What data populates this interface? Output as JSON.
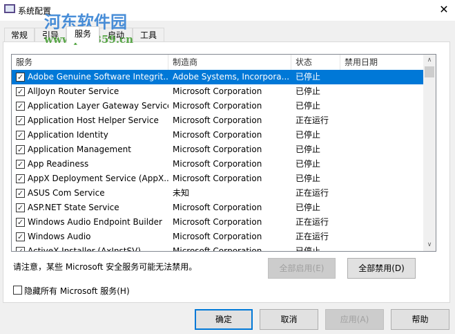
{
  "window": {
    "title": "系统配置",
    "close": "✕"
  },
  "watermark": {
    "line1": "河东软件园",
    "line2": "www.pc0359.cn"
  },
  "tabs": [
    "常规",
    "引导",
    "服务",
    "启动",
    "工具"
  ],
  "columns": [
    "服务",
    "制造商",
    "状态",
    "禁用日期"
  ],
  "rows": [
    {
      "name": "Adobe Genuine Software Integrit...",
      "maker": "Adobe Systems, Incorpora...",
      "status": "已停止",
      "date": ""
    },
    {
      "name": "AllJoyn Router Service",
      "maker": "Microsoft Corporation",
      "status": "已停止",
      "date": ""
    },
    {
      "name": "Application Layer Gateway Service",
      "maker": "Microsoft Corporation",
      "status": "已停止",
      "date": ""
    },
    {
      "name": "Application Host Helper Service",
      "maker": "Microsoft Corporation",
      "status": "正在运行",
      "date": ""
    },
    {
      "name": "Application Identity",
      "maker": "Microsoft Corporation",
      "status": "已停止",
      "date": ""
    },
    {
      "name": "Application Management",
      "maker": "Microsoft Corporation",
      "status": "已停止",
      "date": ""
    },
    {
      "name": "App Readiness",
      "maker": "Microsoft Corporation",
      "status": "已停止",
      "date": ""
    },
    {
      "name": "AppX Deployment Service (AppX...",
      "maker": "Microsoft Corporation",
      "status": "已停止",
      "date": ""
    },
    {
      "name": "ASUS Com Service",
      "maker": "未知",
      "status": "正在运行",
      "date": ""
    },
    {
      "name": "ASP.NET State Service",
      "maker": "Microsoft Corporation",
      "status": "已停止",
      "date": ""
    },
    {
      "name": "Windows Audio Endpoint Builder",
      "maker": "Microsoft Corporation",
      "status": "正在运行",
      "date": ""
    },
    {
      "name": "Windows Audio",
      "maker": "Microsoft Corporation",
      "status": "正在运行",
      "date": ""
    },
    {
      "name": "ActiveX Installer (AxInstSV)",
      "maker": "Microsoft Corporation",
      "status": "已停止",
      "date": ""
    }
  ],
  "note": "请注意，某些 Microsoft 安全服务可能无法禁用。",
  "enable_all": "全部启用(E)",
  "disable_all": "全部禁用(D)",
  "hide_ms": "隐藏所有 Microsoft 服务(H)",
  "buttons": {
    "ok": "确定",
    "cancel": "取消",
    "apply": "应用(A)",
    "help": "帮助"
  }
}
